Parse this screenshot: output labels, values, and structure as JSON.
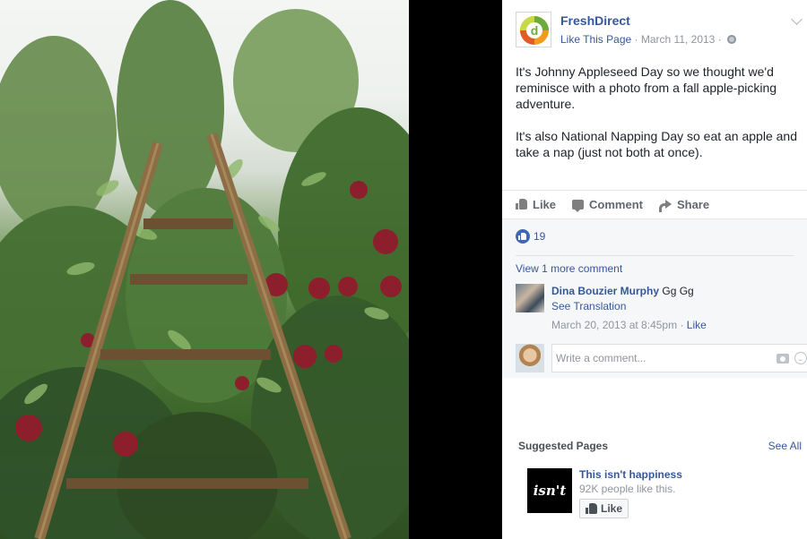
{
  "post": {
    "page_name": "FreshDirect",
    "like_this_page": "Like This Page",
    "separator": "·",
    "date": "March 11, 2013",
    "paragraph_1": "It's Johnny Appleseed Day so we thought we'd reminisce with a photo from a fall apple-picking adventure.",
    "paragraph_2": "It's also National Napping Day so eat an apple and take a nap (just not both at once).",
    "avatar_letter": "d"
  },
  "actions": {
    "like": "Like",
    "comment": "Comment",
    "share": "Share"
  },
  "reactions": {
    "count": "19"
  },
  "comments": {
    "view_more": "View 1 more comment",
    "item": {
      "author": "Dina Bouzier Murphy",
      "text": "Gg Gg",
      "see_translation": "See Translation",
      "timestamp": "March 20, 2013 at 8:45pm",
      "separator": "·",
      "like": "Like"
    },
    "write_placeholder": "Write a comment..."
  },
  "suggested": {
    "title": "Suggested Pages",
    "see_all": "See All",
    "page_name": "This isn't happiness",
    "likes": "92K people like this.",
    "like_button": "Like",
    "logo_text": "isn't"
  },
  "colors": {
    "link": "#365899",
    "like_blue": "#4267b2",
    "muted": "#90949c"
  }
}
